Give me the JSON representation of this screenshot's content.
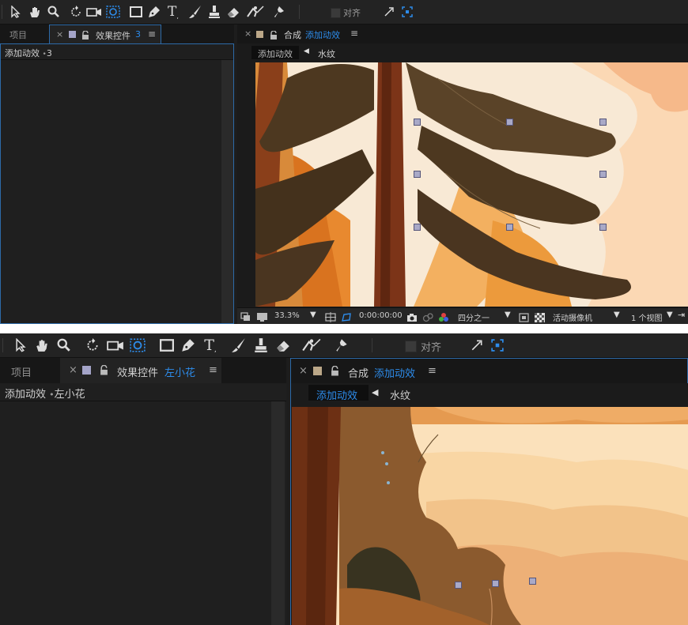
{
  "top": {
    "tools": [
      "selection-tool",
      "hand-tool",
      "zoom-tool",
      "rotate-tool",
      "camera-tool",
      "pan-behind-tool",
      "rectangle-tool",
      "pen-tool",
      "text-tool",
      "brush-tool",
      "clone-stamp-tool",
      "eraser-tool",
      "roto-brush-tool",
      "puppet-pin-tool"
    ],
    "align_label": "对齐",
    "left_tabs": {
      "project": "项目",
      "effect_controls": "效果控件",
      "effect_target": "3"
    },
    "effect_path": {
      "comp": "添加动效",
      "dot": "•",
      "layer": "3"
    },
    "comp_tab": {
      "label": "合成",
      "name": "添加动效"
    },
    "breadcrumbs": [
      "添加动效",
      "水纹"
    ],
    "status": {
      "zoom": "33.3%",
      "timecode": "0:00:00:00",
      "resolution": "四分之一",
      "camera": "活动摄像机",
      "views": "1 个视图"
    }
  },
  "bottom": {
    "align_label": "对齐",
    "left_tabs": {
      "project": "项目",
      "effect_controls": "效果控件",
      "effect_target": "左小花"
    },
    "effect_path": {
      "comp": "添加动效",
      "dot": "•",
      "layer": "左小花"
    },
    "comp_tab": {
      "label": "合成",
      "name": "添加动效"
    },
    "breadcrumbs": [
      "添加动效",
      "水纹"
    ]
  },
  "colors": {
    "accent": "#2d8ceb",
    "panel": "#1f1f1f",
    "tabbar": "#171717",
    "handle": "#a9a9c7"
  },
  "icons": {
    "close": "×",
    "menu": "≡",
    "lock": "lock-icon",
    "arrow": "◀"
  }
}
